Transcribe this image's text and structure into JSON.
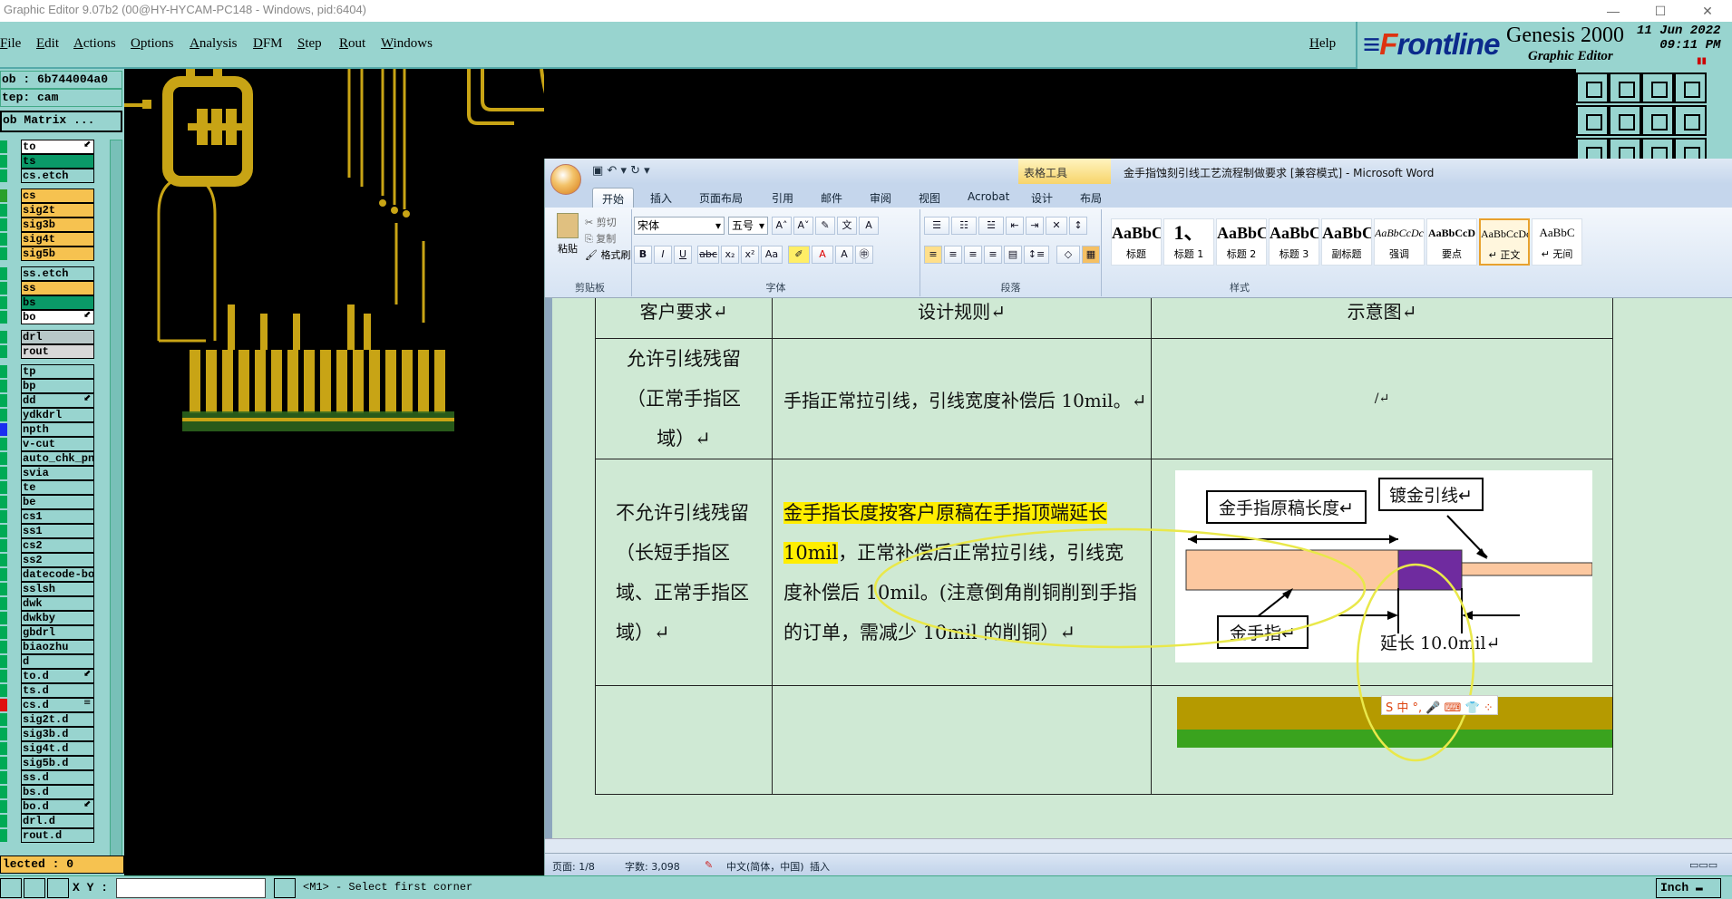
{
  "titlebar": {
    "title": "Graphic Editor 9.07b2 (00@HY-HYCAM-PC148 - Windows, pid:6404)"
  },
  "genesis_menu": [
    "File",
    "Edit",
    "Actions",
    "Options",
    "Analysis",
    "DFM",
    "Step",
    "Rout",
    "Windows"
  ],
  "help_label": "Help",
  "brand": {
    "logo_front": "F",
    "logo_rest": "rontline",
    "product": "Genesis 2000",
    "subtitle": "Graphic Editor",
    "date": "11 Jun 2022",
    "time": "09:11 PM"
  },
  "left_info": {
    "job": "ob : 6b744004a0",
    "step": "tep: cam",
    "matrix_button": "ob Matrix ..."
  },
  "layers": [
    {
      "name": "to",
      "color": "#ffffff",
      "mk": "⬋"
    },
    {
      "name": "ts",
      "color": "#0a9a68",
      "mk": ""
    },
    {
      "name": "cs.etch",
      "color": "#98d4cf",
      "mk": ""
    },
    {
      "name": "cs",
      "color": "#f6c250",
      "mk": ""
    },
    {
      "name": "sig2t",
      "color": "#f6c250",
      "mk": ""
    },
    {
      "name": "sig3b",
      "color": "#f6c250",
      "mk": ""
    },
    {
      "name": "sig4t",
      "color": "#f6c250",
      "mk": ""
    },
    {
      "name": "sig5b",
      "color": "#f6c250",
      "mk": ""
    },
    {
      "name": "ss.etch",
      "color": "#98d4cf",
      "mk": ""
    },
    {
      "name": "ss",
      "color": "#f6c250",
      "mk": ""
    },
    {
      "name": "bs",
      "color": "#0a9a68",
      "mk": ""
    },
    {
      "name": "bo",
      "color": "#ffffff",
      "mk": "⬋"
    },
    {
      "name": "drl",
      "color": "#b8c8c8",
      "mk": ""
    },
    {
      "name": "rout",
      "color": "#d8d8d8",
      "mk": ""
    },
    {
      "name": "tp",
      "color": "#98d4cf",
      "mk": ""
    },
    {
      "name": "bp",
      "color": "#98d4cf",
      "mk": ""
    },
    {
      "name": "dd",
      "color": "#98d4cf",
      "mk": "⬋"
    },
    {
      "name": "ydkdrl",
      "color": "#98d4cf",
      "mk": ""
    },
    {
      "name": "npth",
      "color": "#98d4cf",
      "mk": ""
    },
    {
      "name": "v-cut",
      "color": "#98d4cf",
      "mk": ""
    },
    {
      "name": "auto_chk_pn",
      "color": "#98d4cf",
      "mk": ""
    },
    {
      "name": "svia",
      "color": "#98d4cf",
      "mk": ""
    },
    {
      "name": "te",
      "color": "#98d4cf",
      "mk": ""
    },
    {
      "name": "be",
      "color": "#98d4cf",
      "mk": ""
    },
    {
      "name": "cs1",
      "color": "#98d4cf",
      "mk": ""
    },
    {
      "name": "ss1",
      "color": "#98d4cf",
      "mk": ""
    },
    {
      "name": "cs2",
      "color": "#98d4cf",
      "mk": ""
    },
    {
      "name": "ss2",
      "color": "#98d4cf",
      "mk": ""
    },
    {
      "name": "datecode-bo",
      "color": "#98d4cf",
      "mk": ""
    },
    {
      "name": "sslsh",
      "color": "#98d4cf",
      "mk": ""
    },
    {
      "name": "dwk",
      "color": "#98d4cf",
      "mk": ""
    },
    {
      "name": "dwkby",
      "color": "#98d4cf",
      "mk": ""
    },
    {
      "name": "gbdrl",
      "color": "#98d4cf",
      "mk": ""
    },
    {
      "name": "biaozhu",
      "color": "#98d4cf",
      "mk": ""
    },
    {
      "name": "d",
      "color": "#98d4cf",
      "mk": ""
    },
    {
      "name": "to.d",
      "color": "#98d4cf",
      "mk": "⬋"
    },
    {
      "name": "ts.d",
      "color": "#98d4cf",
      "mk": ""
    },
    {
      "name": "cs.d",
      "color": "#98d4cf",
      "mk": "≡"
    },
    {
      "name": "sig2t.d",
      "color": "#98d4cf",
      "mk": ""
    },
    {
      "name": "sig3b.d",
      "color": "#98d4cf",
      "mk": ""
    },
    {
      "name": "sig4t.d",
      "color": "#98d4cf",
      "mk": ""
    },
    {
      "name": "sig5b.d",
      "color": "#98d4cf",
      "mk": ""
    },
    {
      "name": "ss.d",
      "color": "#98d4cf",
      "mk": ""
    },
    {
      "name": "bs.d",
      "color": "#98d4cf",
      "mk": ""
    },
    {
      "name": "bo.d",
      "color": "#98d4cf",
      "mk": "⬋"
    },
    {
      "name": "drl.d",
      "color": "#98d4cf",
      "mk": ""
    },
    {
      "name": "rout.d",
      "color": "#98d4cf",
      "mk": ""
    }
  ],
  "selected_label": "lected : 0",
  "status": {
    "xy_label": "X Y :",
    "message": "<M1> - Select first corner",
    "unit": "Inch"
  },
  "word": {
    "qat": "▣ ↶ ▾ ↻ ▾",
    "context_tab": "表格工具",
    "title": "金手指蚀刻引线工艺流程制做要求 [兼容模式] - Microsoft Word",
    "tabs": [
      "开始",
      "插入",
      "页面布局",
      "引用",
      "邮件",
      "审阅",
      "视图",
      "Acrobat",
      "设计",
      "布局"
    ],
    "clipboard": {
      "paste": "粘贴",
      "cut": "剪切",
      "copy": "复制",
      "format_painter": "格式刷",
      "label": "剪贴板"
    },
    "font": {
      "name": "宋体",
      "size": "五号",
      "label": "字体"
    },
    "paragraph_label": "段落",
    "styles_label": "样式",
    "styles": [
      {
        "preview": "AaBbC",
        "name": "标题"
      },
      {
        "preview": "1、",
        "name": "标题 1"
      },
      {
        "preview": "AaBbC",
        "name": "标题 2"
      },
      {
        "preview": "AaBbC",
        "name": "标题 3"
      },
      {
        "preview": "AaBbC",
        "name": "副标题"
      },
      {
        "preview": "AaBbCcDc",
        "name": "强调"
      },
      {
        "preview": "AaBbCcD",
        "name": "要点"
      },
      {
        "preview": "AaBbCcDc",
        "name": "↵ 正文"
      },
      {
        "preview": "AaBbC",
        "name": "↵ 无间"
      }
    ],
    "table": {
      "headers": [
        "客户要求↵",
        "设计规则↵",
        "示意图↵"
      ],
      "row1": {
        "req": "允许引线残留（正常手指区域）↵",
        "rule": "手指正常拉引线，引线宽度补偿后 10mil。↵",
        "diagram": "/↵"
      },
      "row2": {
        "req": "不允许引线残留（长短手指区域、正常手指区域）↵",
        "rule_highlight": "金手指长度按客户原稿在手指顶端延长 10mil",
        "rule_rest": "，正常补偿后正常拉引线，引线宽度补偿后 10mil。(注意倒角削铜削到手指的订单，需减少 10mil 的削铜）↵",
        "diag_label_orig": "金手指原稿长度↵",
        "diag_label_plate": "镀金引线↵",
        "diag_label_finger": "金手指↵",
        "diag_label_extend": "延长 10.0mil↵"
      }
    },
    "statusbar": {
      "page": "页面: 1/8",
      "words": "字数: 3,098",
      "lang": "中文(简体，中国)",
      "mode": "插入"
    },
    "ime": "S 中 °, 🎤 ⌨ 👕 ⁘"
  },
  "colors": {
    "genesis_panel": "#98d4cf",
    "copper": "#c8a415",
    "word_table_bg": "#cfe9d4",
    "highlight": "#ffee00",
    "annotation_ellipse": "#e9e84a"
  }
}
